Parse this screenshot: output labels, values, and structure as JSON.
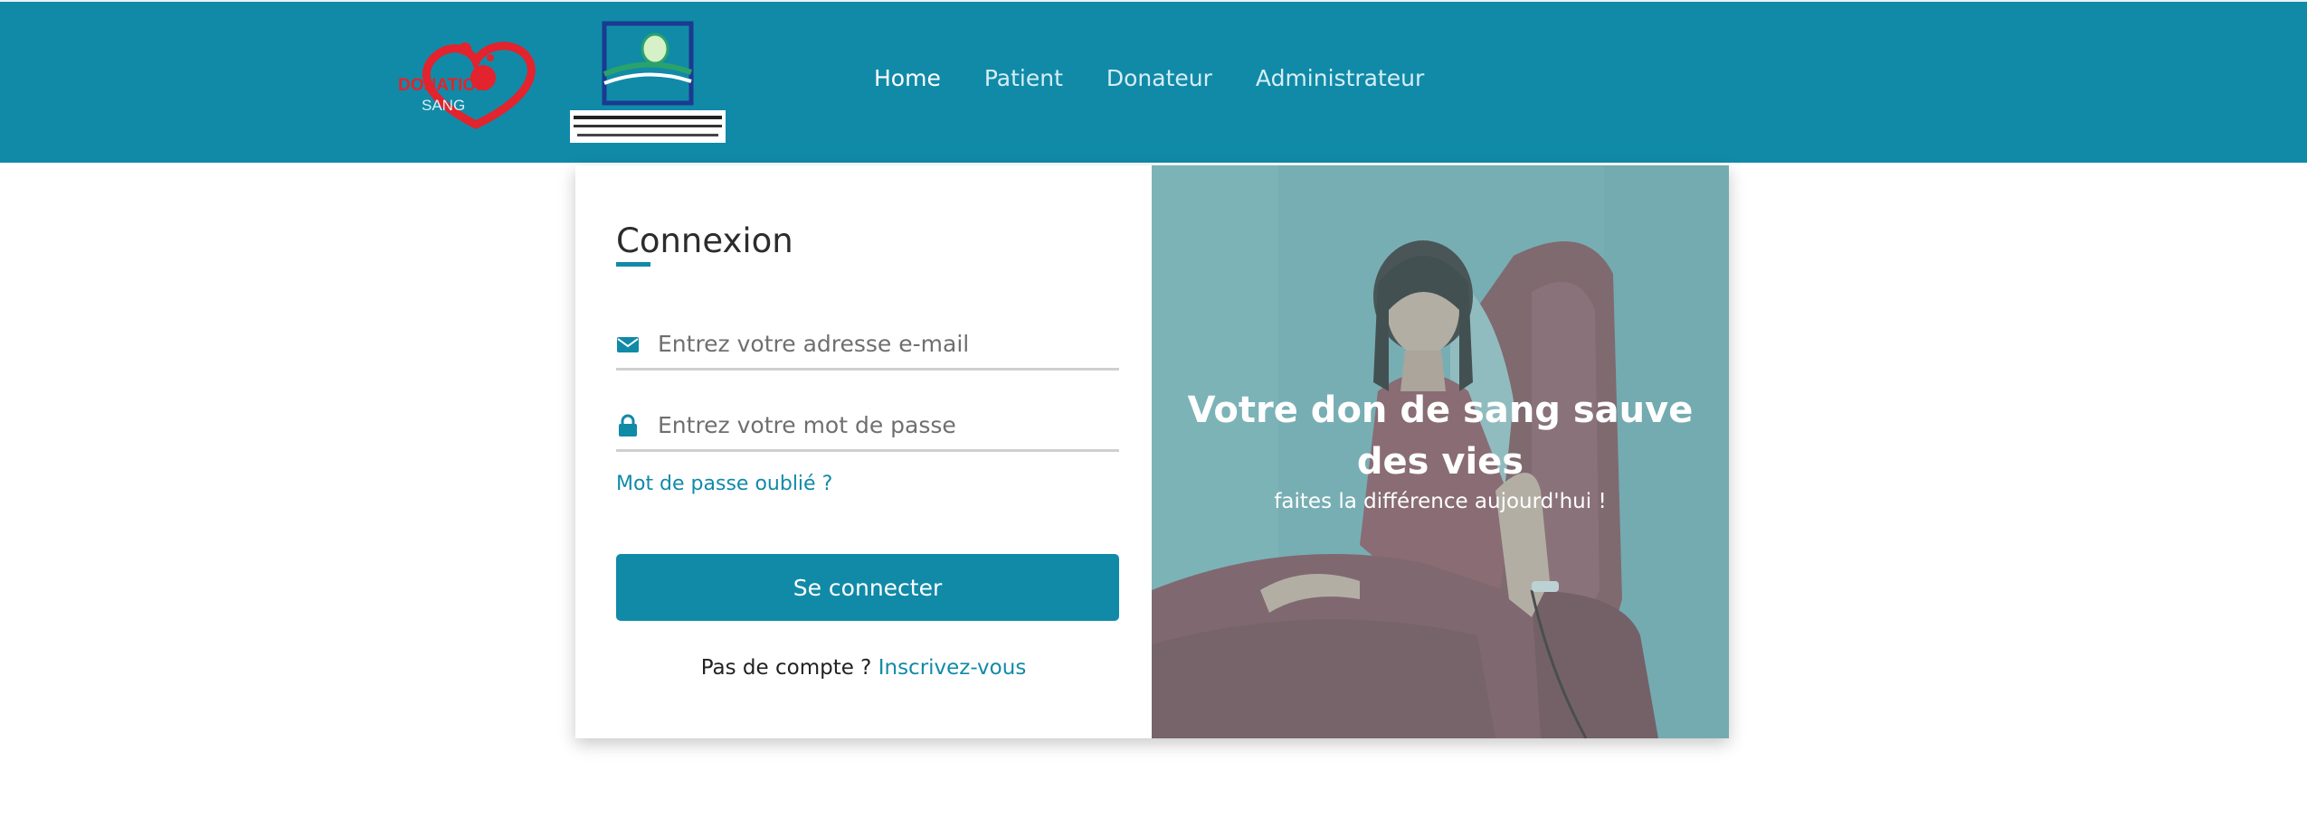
{
  "header": {
    "brand": {
      "logo_icon": "donation-sang-heart-logo",
      "logo_text": "DONATION SANG",
      "ministry_icon": "ministry-emblem-logo",
      "ministry_name_arabic": "وزارة الصحة والحماية الاجتماعية",
      "ministry_name_fr": "Ministère de la Santé et de la Protection Sociale"
    },
    "nav": [
      {
        "label": "Home",
        "active": true
      },
      {
        "label": "Patient",
        "active": false
      },
      {
        "label": "Donateur",
        "active": false
      },
      {
        "label": "Administrateur",
        "active": false
      }
    ]
  },
  "login": {
    "title": "Connexion",
    "email_icon": "envelope-icon",
    "email_placeholder": "Entrez votre adresse e-mail",
    "password_icon": "lock-icon",
    "password_placeholder": "Entrez votre mot de passe",
    "forgot_label": "Mot de passe oublié ?",
    "submit_label": "Se connecter",
    "no_account_text": "Pas de compte ?",
    "signup_label": "Inscrivez-vous"
  },
  "hero": {
    "title": "Votre don de sang sauve des vies",
    "subtitle": "faites la différence aujourd'hui !"
  },
  "colors": {
    "primary": "#118aa8",
    "logo_red": "#e3232d",
    "overlay": "#7fb3b7"
  }
}
